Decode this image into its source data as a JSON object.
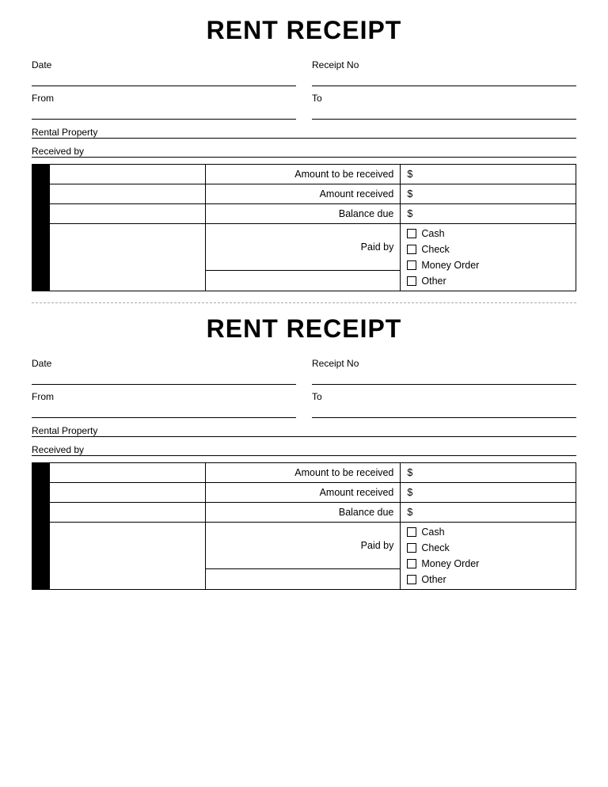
{
  "receipt1": {
    "title": "RENT RECEIPT",
    "date_label": "Date",
    "receipt_no_label": "Receipt No",
    "from_label": "From",
    "to_label": "To",
    "rental_property_label": "Rental Property",
    "received_by_label": "Received by",
    "table": {
      "amount_to_be_received_label": "Amount to be received",
      "amount_received_label": "Amount received",
      "balance_due_label": "Balance due",
      "dollar": "$",
      "paid_by_label": "Paid by",
      "checkboxes": [
        {
          "label": "Cash"
        },
        {
          "label": "Check"
        },
        {
          "label": "Money Order"
        },
        {
          "label": "Other"
        }
      ]
    }
  },
  "receipt2": {
    "title": "RENT RECEIPT",
    "date_label": "Date",
    "receipt_no_label": "Receipt No",
    "from_label": "From",
    "to_label": "To",
    "rental_property_label": "Rental Property",
    "received_by_label": "Received by",
    "table": {
      "amount_to_be_received_label": "Amount to be received",
      "amount_received_label": "Amount received",
      "balance_due_label": "Balance due",
      "dollar": "$",
      "paid_by_label": "Paid by",
      "checkboxes": [
        {
          "label": "Cash"
        },
        {
          "label": "Check"
        },
        {
          "label": "Money Order"
        },
        {
          "label": "Other"
        }
      ]
    }
  }
}
